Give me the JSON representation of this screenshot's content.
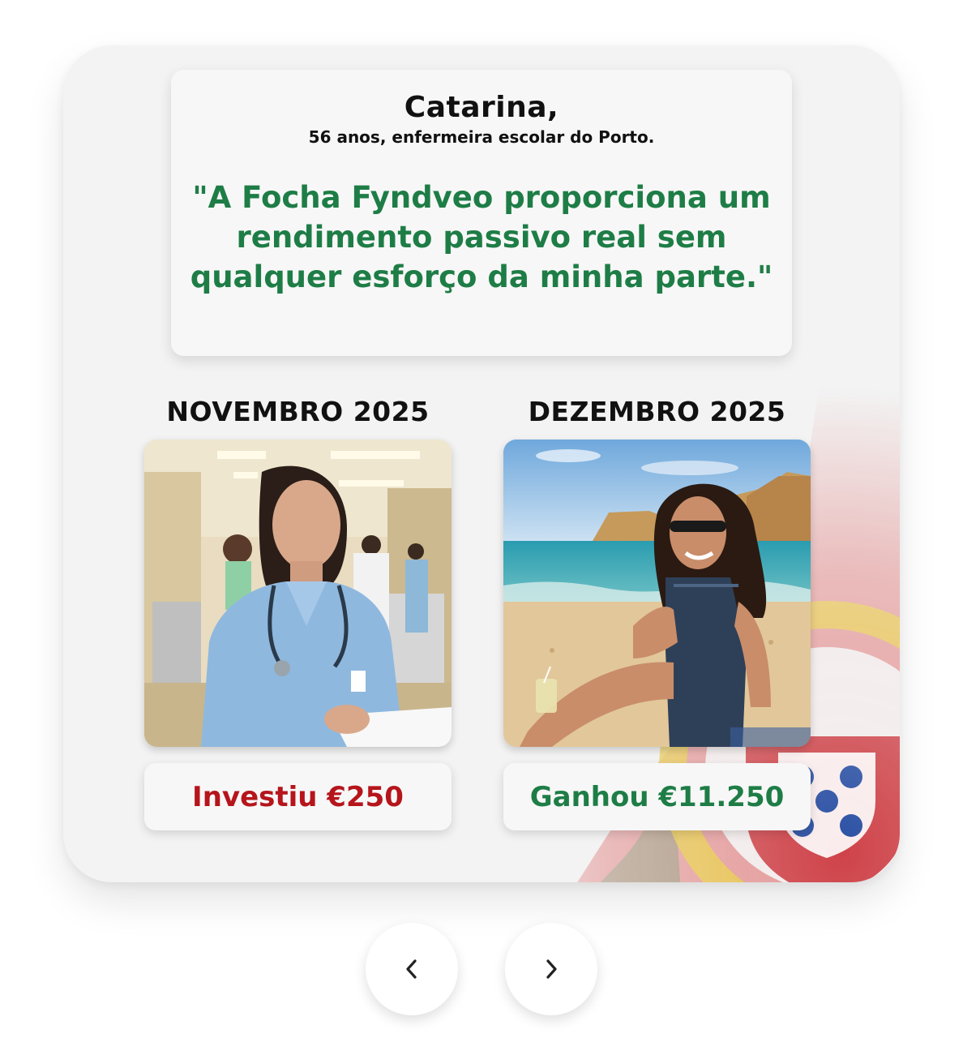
{
  "testimonial": {
    "name": "Catarina,",
    "description": "56 anos, enfermeira escolar do Porto.",
    "quote": "\"A Focha Fyndveo proporciona um rendimento passivo real sem qualquer esforço da minha parte.\""
  },
  "before": {
    "month_label": "NOVEMBRO 2025",
    "amount_label": "Investiu €250",
    "amount_color": "#b5151b"
  },
  "after": {
    "month_label": "DEZEMBRO 2025",
    "amount_label": "Ganhou €11.250",
    "amount_color": "#1e7d46"
  },
  "navigation": {
    "prev_icon": "chevron-left-icon",
    "next_icon": "chevron-right-icon"
  },
  "colors": {
    "quote_green": "#1e7d46",
    "invest_red": "#b5151b",
    "card_bg": "#f3f3f3"
  }
}
